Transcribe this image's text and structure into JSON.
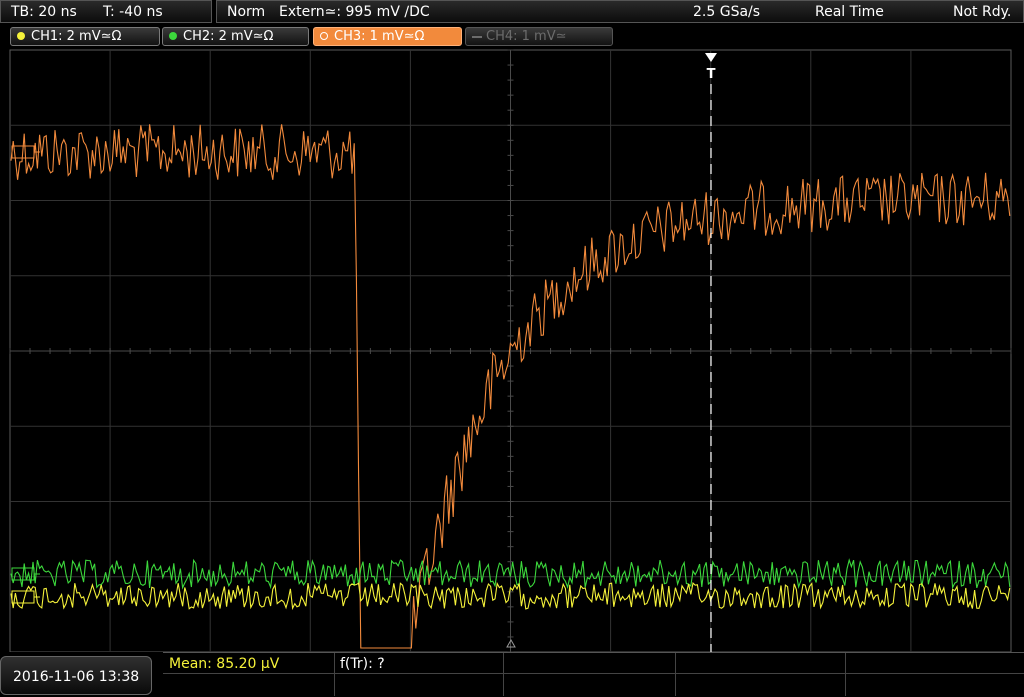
{
  "topbar": {
    "tb": "TB: 20 ns",
    "t": "T: -40 ns",
    "mode": "Norm",
    "trigger": "Extern≃: 995 mV ∕DC",
    "sample_rate": "2.5 GSa/s",
    "acq_mode": "Real Time",
    "status": "Not Rdy."
  },
  "channels": [
    {
      "label": "CH1: 2 mV≃Ω",
      "color": "#f5f23a",
      "state": "on"
    },
    {
      "label": "CH2: 2 mV≃Ω",
      "color": "#3cd83c",
      "state": "on"
    },
    {
      "label": "CH3: 1 mV≃Ω",
      "color": "#f28a3c",
      "state": "active"
    },
    {
      "label": "CH4: 1 mV≃",
      "color": "#6c6c6c",
      "state": "off"
    }
  ],
  "trigger_marker": "T",
  "measurements": {
    "mean": "Mean: 85.20 µV",
    "ftr": "f(Tr): ?"
  },
  "datetime": "2016-11-06 13:38",
  "colors": {
    "ch1": "#f5f23a",
    "ch2": "#3cd83c",
    "ch3": "#f28a3c",
    "grid": "#3a3a3a"
  }
}
